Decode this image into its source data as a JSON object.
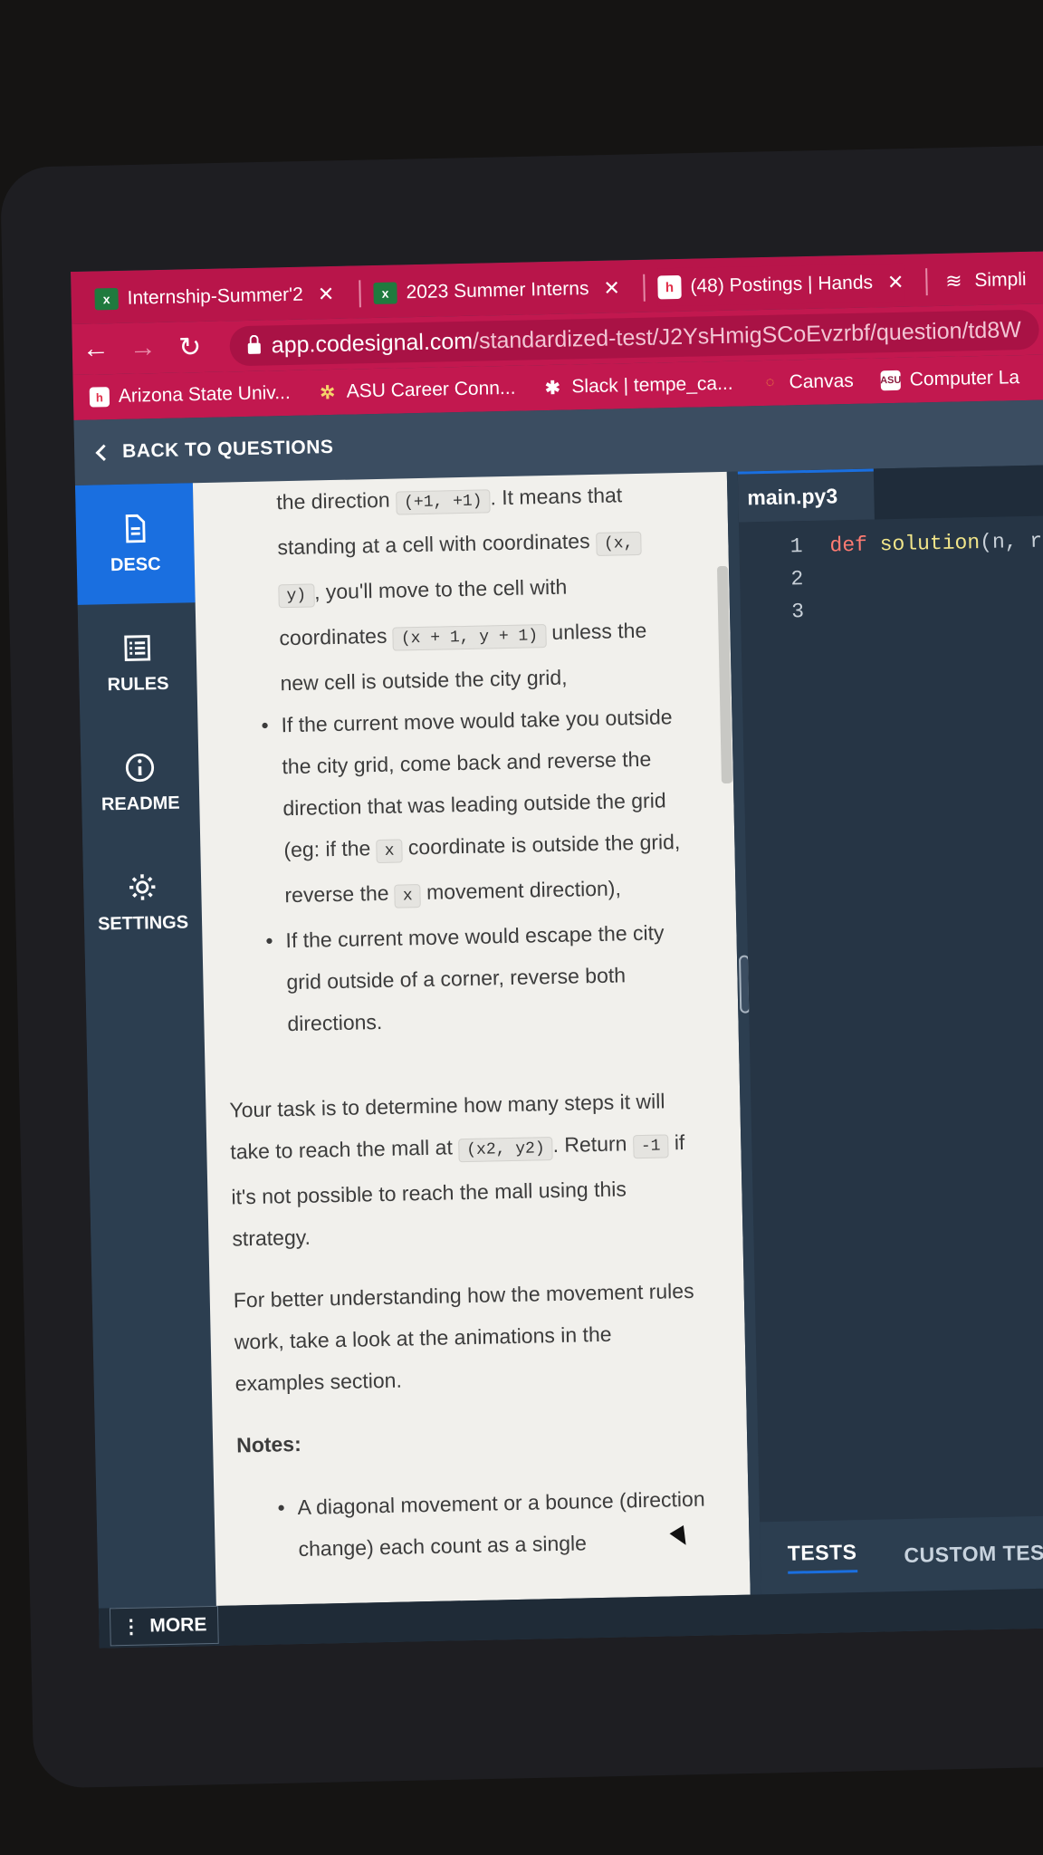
{
  "browser": {
    "tabs": [
      {
        "label": "Internship-Summer'2",
        "icon": "excel-icon"
      },
      {
        "label": "2023 Summer Interns",
        "icon": "excel-icon"
      },
      {
        "label": "(48) Postings | Hands",
        "icon": "handshake-icon"
      },
      {
        "label": "Simpli",
        "icon": "simplify-icon"
      }
    ],
    "close_glyph": "✕",
    "url_host": "app.codesignal.com",
    "url_path": "/standardized-test/J2YsHmigSCoEvzrbf/question/td8W",
    "bookmarks": [
      {
        "label": "Arizona State Univ...",
        "icon": "handshake-icon"
      },
      {
        "label": "ASU Career Conn...",
        "icon": "gear-icon"
      },
      {
        "label": "Slack | tempe_ca...",
        "icon": "slack-icon"
      },
      {
        "label": "Canvas",
        "icon": "canvas-icon"
      },
      {
        "label": "Computer La",
        "icon": "asu-icon"
      }
    ]
  },
  "header": {
    "back_label": "BACK TO QUESTIONS"
  },
  "leftnav": [
    {
      "label": "DESC",
      "icon": "document-icon"
    },
    {
      "label": "RULES",
      "icon": "list-icon"
    },
    {
      "label": "README",
      "icon": "info-icon"
    },
    {
      "label": "SETTINGS",
      "icon": "settings-icon"
    }
  ],
  "description": {
    "l1a": "the direction ",
    "c1": "(+1, +1)",
    "l1b": ". It means that",
    "l2a": "standing at a cell with coordinates ",
    "c2": "(x,",
    "c3": "y)",
    "l3b": ", you'll move to the cell with",
    "l4a": "coordinates ",
    "c4": "(x + 1, y + 1)",
    "l4b": " unless the",
    "l5": "new cell is outside the city grid,",
    "b2a": "If the current move would take you outside the city grid, come back and reverse the direction that was leading outside the grid (eg: if the ",
    "b2c1": "x",
    "b2b": " coordinate is outside the grid, reverse the ",
    "b2c2": "x",
    "b2d": " movement direction),",
    "b3": "If the current move would escape the city grid outside of a corner, reverse both directions.",
    "p1a": "Your task is to determine how many steps it will take to reach the mall at ",
    "p1c1": "(x2, y2)",
    "p1b": ". Return ",
    "p1c2": "-1",
    "p1d": " if it's not possible to reach the mall using this strategy.",
    "p2": "For better understanding how the movement rules work, take a look at the animations in the examples section.",
    "notes": "Notes:",
    "n1": "A diagonal movement or a bounce (direction change) each count as a single"
  },
  "editor": {
    "file_tab": "main.py3",
    "line_numbers": [
      "1",
      "2",
      "3"
    ],
    "kw": "def",
    "fn": "solution",
    "rest": "(n, r"
  },
  "bottom": {
    "tests_tab": "TESTS",
    "custom_tab": "CUSTOM TES",
    "more_label": "MORE"
  }
}
